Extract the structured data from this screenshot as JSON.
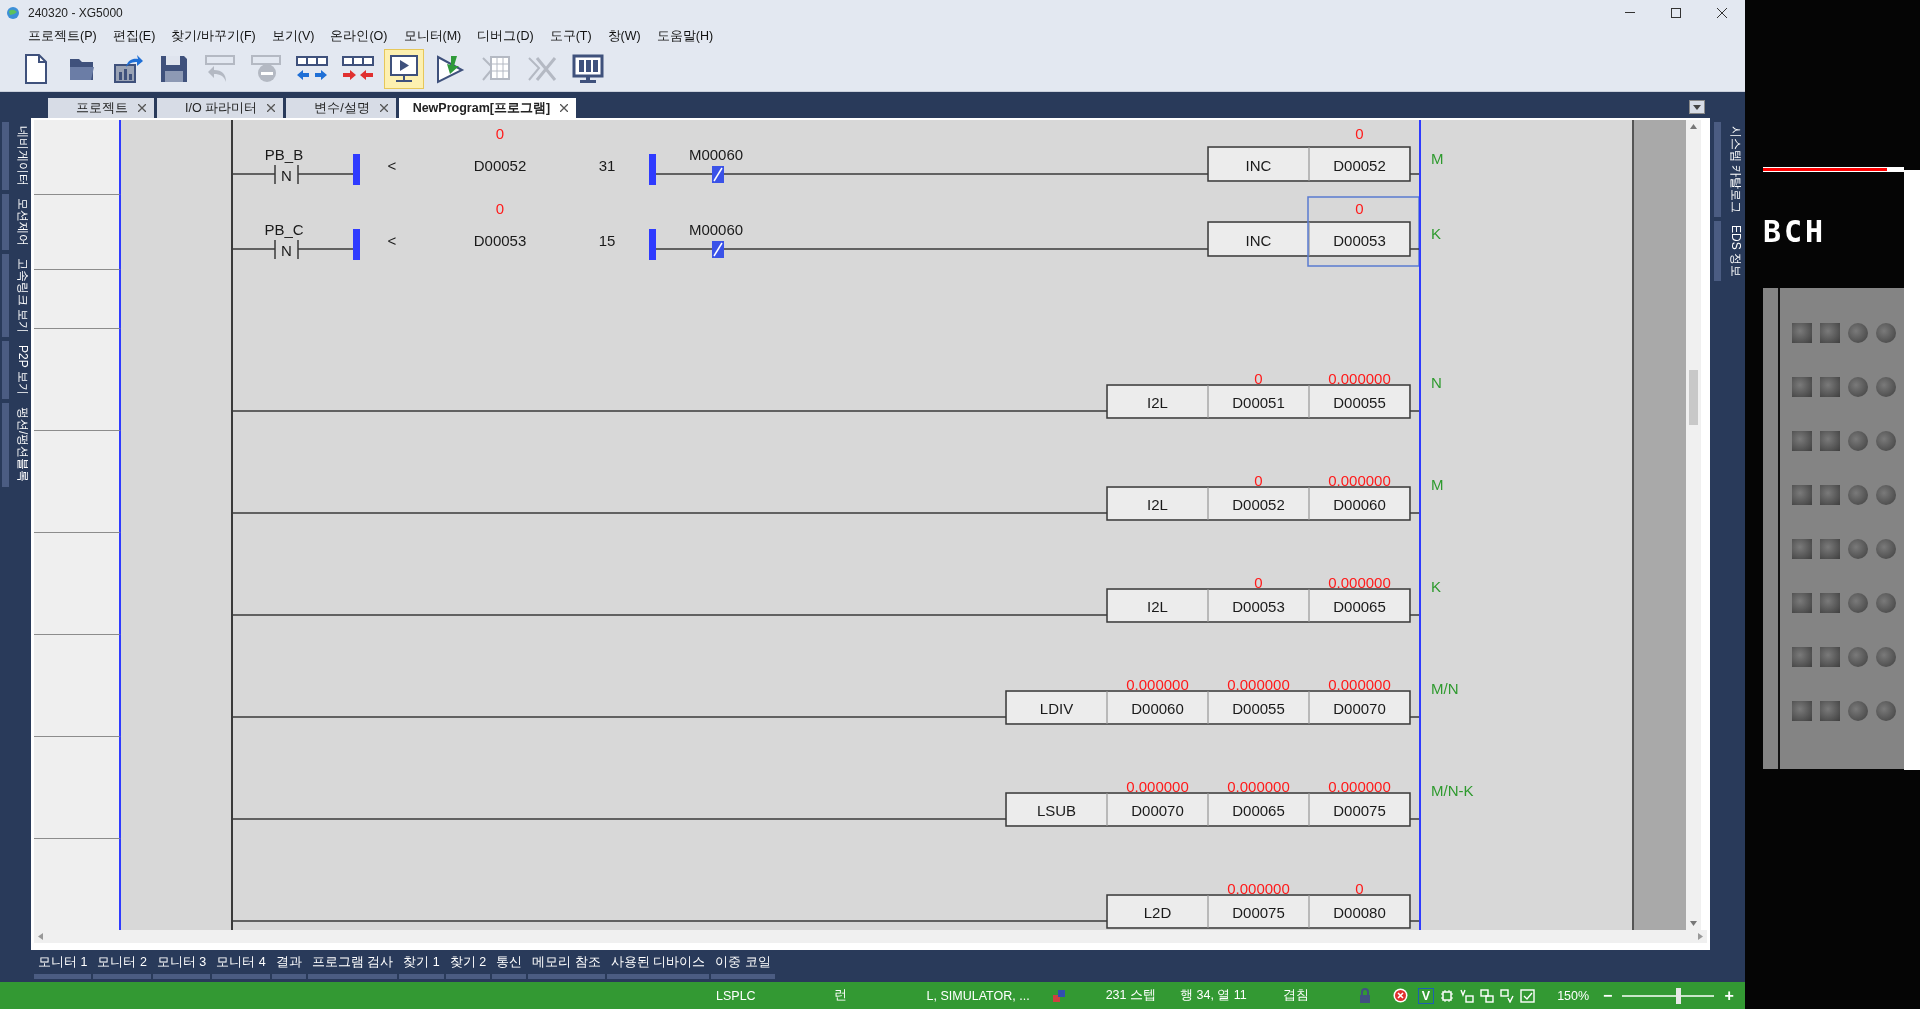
{
  "window": {
    "title": "240320 - XG5000"
  },
  "menu": [
    "프로젝트(P)",
    "편집(E)",
    "찾기/바꾸기(F)",
    "보기(V)",
    "온라인(O)",
    "모니터(M)",
    "디버그(D)",
    "도구(T)",
    "창(W)",
    "도움말(H)"
  ],
  "toolbar": [
    {
      "kind": "new",
      "disabled": false,
      "selected": false
    },
    {
      "kind": "open",
      "disabled": false,
      "selected": false
    },
    {
      "kind": "export",
      "disabled": false,
      "selected": false
    },
    {
      "kind": "save",
      "disabled": false,
      "selected": false
    },
    {
      "kind": "undo",
      "disabled": true,
      "selected": false
    },
    {
      "kind": "remove",
      "disabled": true,
      "selected": false
    },
    {
      "kind": "connect",
      "disabled": false,
      "selected": false
    },
    {
      "kind": "disconnect",
      "disabled": false,
      "selected": false
    },
    {
      "kind": "monitor",
      "disabled": false,
      "selected": true
    },
    {
      "kind": "download",
      "disabled": false,
      "selected": false
    },
    {
      "kind": "table",
      "disabled": true,
      "selected": false
    },
    {
      "kind": "cross",
      "disabled": true,
      "selected": false
    },
    {
      "kind": "display",
      "disabled": false,
      "selected": false
    }
  ],
  "left_side_tabs": [
    "네비게이터",
    "모션제어",
    "고속링크 보기",
    "P2P 보기",
    "펑션/펑션블록"
  ],
  "document_tabs": [
    {
      "label": "프로젝트",
      "selected": false
    },
    {
      "label": "I/O 파라미터",
      "selected": false
    },
    {
      "label": "변수/설명",
      "selected": false
    },
    {
      "label": "NewProgram[프로그램]",
      "selected": true
    }
  ],
  "right_side_tabs": [
    "시스템 카탈로그",
    "EDS 정보"
  ],
  "ladder": {
    "rungs": [
      {
        "kind": "compare",
        "contact": {
          "label": "PB_B",
          "symbol": "N"
        },
        "operator": "<",
        "operand": {
          "value": "0",
          "device": "D00052"
        },
        "constant": "31",
        "interlock": "M00060",
        "cells": [
          {
            "text": "INC",
            "selected": false
          },
          {
            "value": "0",
            "text": "D00052",
            "selected": false
          }
        ],
        "comment": "M"
      },
      {
        "kind": "compare",
        "contact": {
          "label": "PB_C",
          "symbol": "N"
        },
        "operator": "<",
        "operand": {
          "value": "0",
          "device": "D00053"
        },
        "constant": "15",
        "interlock": "M00060",
        "cells": [
          {
            "text": "INC",
            "selected": false
          },
          {
            "value": "0",
            "text": "D00053",
            "selected": true
          }
        ],
        "comment": "K"
      },
      {
        "kind": "function",
        "cells": [
          {
            "text": "I2L",
            "selected": false
          },
          {
            "value": "0",
            "text": "D00051",
            "selected": false
          },
          {
            "value": "0.000000",
            "text": "D00055",
            "selected": false
          }
        ],
        "comment": "N"
      },
      {
        "kind": "function",
        "cells": [
          {
            "text": "I2L",
            "selected": false
          },
          {
            "value": "0",
            "text": "D00052",
            "selected": false
          },
          {
            "value": "0.000000",
            "text": "D00060",
            "selected": false
          }
        ],
        "comment": "M"
      },
      {
        "kind": "function",
        "cells": [
          {
            "text": "I2L",
            "selected": false
          },
          {
            "value": "0",
            "text": "D00053",
            "selected": false
          },
          {
            "value": "0.000000",
            "text": "D00065",
            "selected": false
          }
        ],
        "comment": "K"
      },
      {
        "kind": "function",
        "cells": [
          {
            "text": "LDIV",
            "selected": false
          },
          {
            "value": "0.000000",
            "text": "D00060",
            "selected": false
          },
          {
            "value": "0.000000",
            "text": "D00055",
            "selected": false
          },
          {
            "value": "0.000000",
            "text": "D00070",
            "selected": false
          }
        ],
        "comment": "M/N"
      },
      {
        "kind": "function",
        "cells": [
          {
            "text": "LSUB",
            "selected": false
          },
          {
            "value": "0.000000",
            "text": "D00070",
            "selected": false
          },
          {
            "value": "0.000000",
            "text": "D00065",
            "selected": false
          },
          {
            "value": "0.000000",
            "text": "D00075",
            "selected": false
          }
        ],
        "comment": "M/N-K"
      },
      {
        "kind": "function",
        "cells": [
          {
            "text": "L2D",
            "selected": false
          },
          {
            "value": "0.000000",
            "text": "D00075",
            "selected": false
          },
          {
            "value": "0",
            "text": "D00080",
            "selected": false
          }
        ]
      }
    ]
  },
  "bottom_tabs": [
    "모니터 1",
    "모니터 2",
    "모니터 3",
    "모니터 4",
    "결과",
    "프로그램 검사",
    "찾기 1",
    "찾기 2",
    "통신",
    "메모리 참조",
    "사용된 디바이스",
    "이중 코일"
  ],
  "status_bar": {
    "plc_type": "LSPLC",
    "mode": "런",
    "connection": "L, SIMULATOR, ...",
    "steps": "231 스텝",
    "position": "행 34, 열 11",
    "insert_mode": "겹침",
    "badge": "V",
    "zoom": "150%",
    "zoom_out": "−",
    "zoom_in": "+",
    "level": 0.6
  },
  "simulator": {
    "label": "BCH",
    "led_rows": [
      [
        {
          "on": false
        },
        {
          "on": false
        },
        {
          "on": false
        },
        {
          "on": false
        }
      ],
      [
        {
          "on": false
        },
        {
          "on": false
        },
        {
          "on": false
        },
        {
          "on": false
        }
      ],
      [
        {
          "on": false
        },
        {
          "on": false
        },
        {
          "on": false
        },
        {
          "on": false
        }
      ],
      [
        {
          "on": false
        },
        {
          "on": false
        },
        {
          "on": false
        },
        {
          "on": false
        }
      ],
      [
        {
          "on": false
        },
        {
          "on": false
        },
        {
          "on": false
        },
        {
          "on": false
        }
      ],
      [
        {
          "on": false
        },
        {
          "on": false
        },
        {
          "on": false
        },
        {
          "on": false
        }
      ],
      [
        {
          "on": false
        },
        {
          "on": false
        },
        {
          "on": false
        },
        {
          "on": false
        }
      ],
      [
        {
          "on": false
        },
        {
          "on": false
        },
        {
          "on": false
        },
        {
          "on": false
        }
      ]
    ]
  }
}
